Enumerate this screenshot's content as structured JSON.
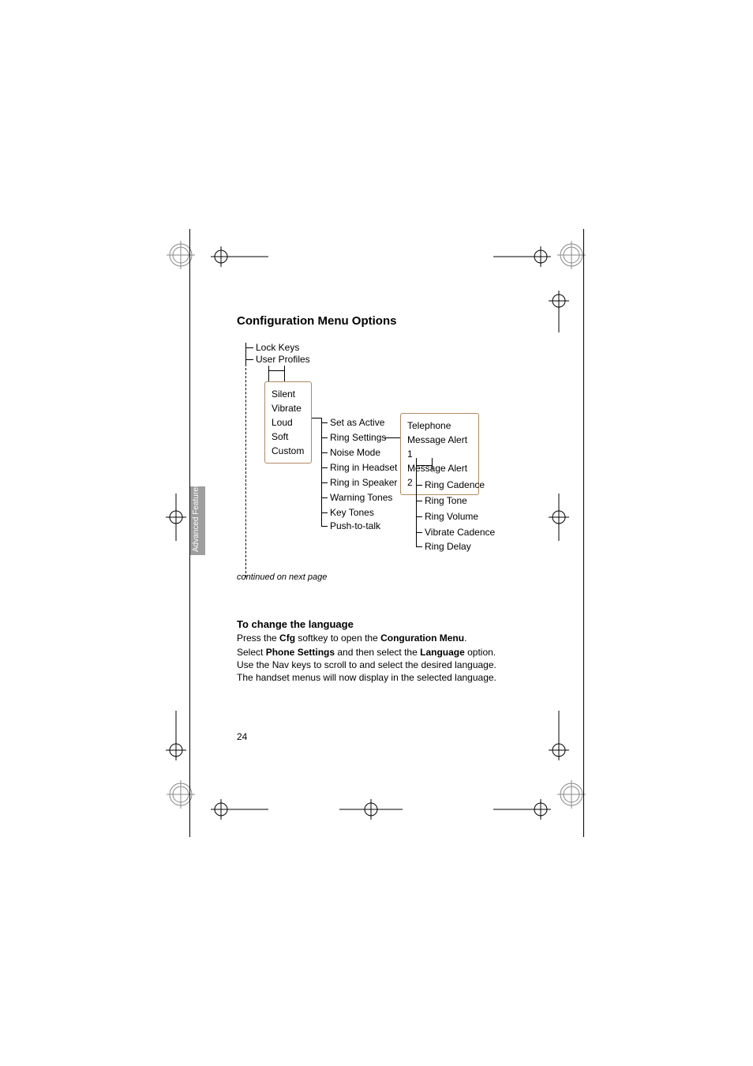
{
  "sidebar_label": "Advanced Features",
  "title": "Configuration Menu Options",
  "diagram": {
    "root_items": [
      "Lock Keys",
      "User Profiles"
    ],
    "profiles": [
      "Silent",
      "Vibrate",
      "Loud",
      "Soft",
      "Custom"
    ],
    "settings": [
      "Set as Active",
      "Ring Settings",
      "Noise Mode",
      "Ring in Headset",
      "Ring in Speaker",
      "Warning Tones",
      "Key Tones",
      "Push-to-talk"
    ],
    "alerts": [
      "Telephone",
      "Message Alert 1",
      "Message Alert 2"
    ],
    "ring_opts": [
      "Ring Cadence",
      "Ring Tone",
      "Ring Volume",
      "Vibrate Cadence",
      "Ring Delay"
    ]
  },
  "continued": "continued on next page",
  "lang_heading": "To change the language",
  "lang_p1_pre": "Press the ",
  "lang_p1_b1": "Cfg",
  "lang_p1_mid": " softkey to open the ",
  "lang_p1_b2": "Conguration Menu",
  "lang_p1_end": ".",
  "lang_p2_pre": "Select ",
  "lang_p2_b1": "Phone Settings",
  "lang_p2_mid": " and then select the ",
  "lang_p2_b2": "Language",
  "lang_p2_end": " option. Use the Nav keys to scroll to and select the desired language. The handset menus will now display in the selected language.",
  "page_number": "24"
}
